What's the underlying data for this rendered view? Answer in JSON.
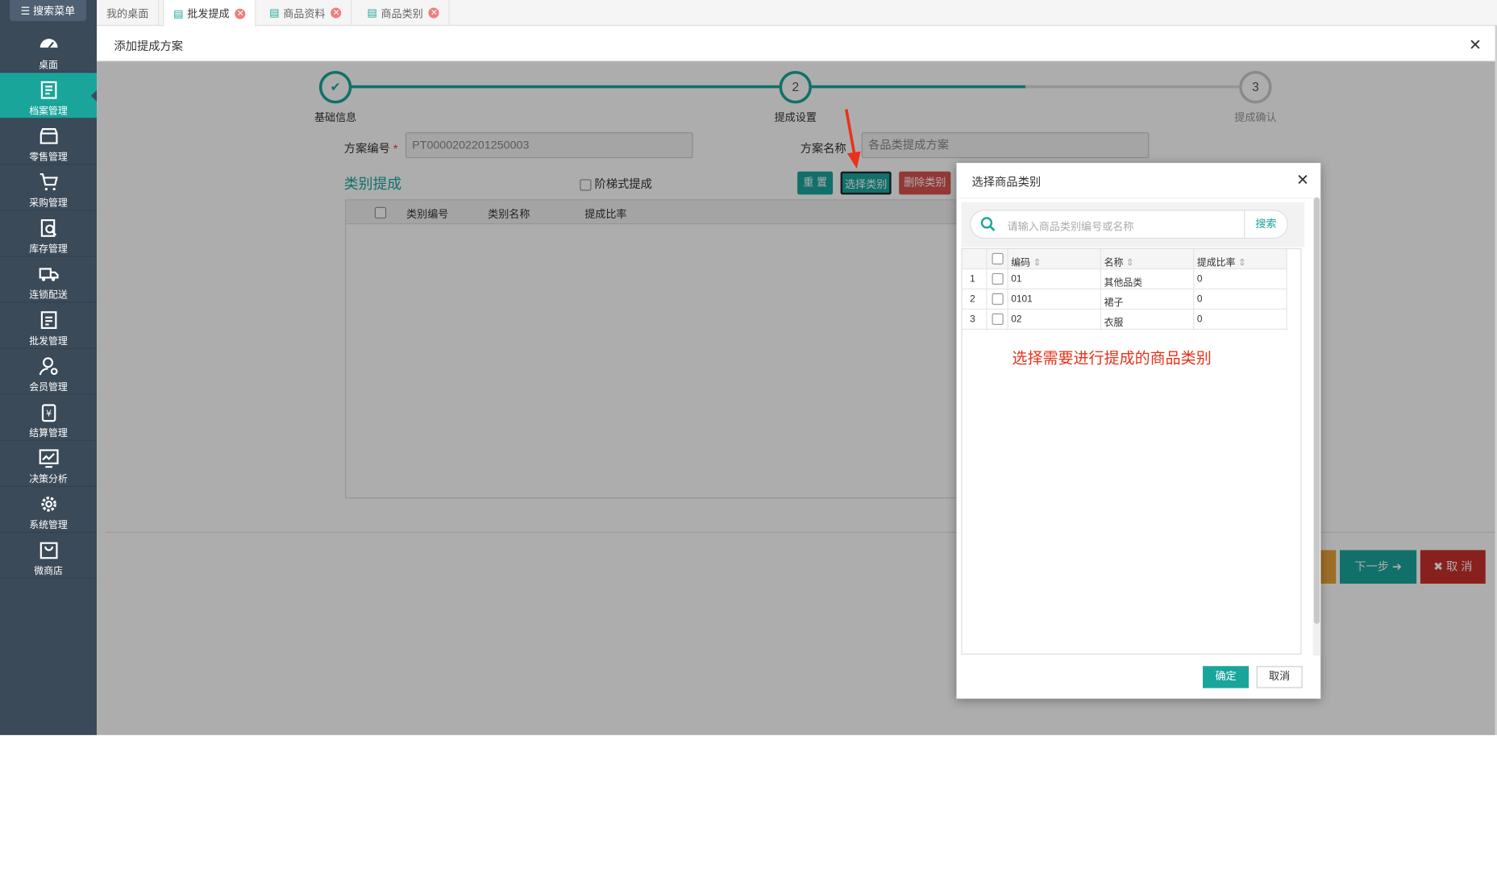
{
  "sidebar": {
    "search_menu": "搜索菜单",
    "items": [
      {
        "label": "桌面",
        "icon": "dashboard-icon"
      },
      {
        "label": "档案管理",
        "icon": "archive-icon"
      },
      {
        "label": "零售管理",
        "icon": "store-icon"
      },
      {
        "label": "采购管理",
        "icon": "cart-icon"
      },
      {
        "label": "库存管理",
        "icon": "inventory-icon"
      },
      {
        "label": "连锁配送",
        "icon": "truck-icon"
      },
      {
        "label": "批发管理",
        "icon": "wholesale-icon"
      },
      {
        "label": "会员管理",
        "icon": "member-icon"
      },
      {
        "label": "结算管理",
        "icon": "settlement-icon"
      },
      {
        "label": "决策分析",
        "icon": "chart-icon"
      },
      {
        "label": "系统管理",
        "icon": "gear-icon"
      },
      {
        "label": "微商店",
        "icon": "bag-icon"
      }
    ],
    "active_index": 1
  },
  "tabs": [
    {
      "label": "我的桌面"
    },
    {
      "label": "批发提成"
    },
    {
      "label": "商品资料"
    },
    {
      "label": "商品类别"
    }
  ],
  "dialog": {
    "title": "添加提成方案",
    "close": "✕"
  },
  "steps": [
    {
      "label": "基础信息",
      "num": "✔"
    },
    {
      "label": "提成设置",
      "num": "2"
    },
    {
      "label": "提成确认",
      "num": "3"
    }
  ],
  "form": {
    "plan_no_label": "方案编号",
    "required_mark": "*",
    "plan_no_value": "PT0000202201250003",
    "plan_name_label": "方案名称",
    "plan_name_value": "各品类提成方案",
    "section_title": "类别提成",
    "tiered_label": "阶梯式提成",
    "btn_reset": "重 置",
    "btn_select": "选择类别",
    "btn_delete": "删除类别",
    "table_headers": [
      "类别编号",
      "类别名称",
      "提成比率"
    ]
  },
  "bottom_buttons": {
    "next": "下一步 ➔",
    "cancel": "✖ 取 消"
  },
  "modal": {
    "title": "选择商品类别",
    "close": "✕",
    "search_placeholder": "请输入商品类别编号或名称",
    "search_button": "搜索",
    "headers": [
      "编码",
      "名称",
      "提成比率"
    ],
    "rows": [
      {
        "idx": "1",
        "code": "01",
        "name": "其他品类",
        "rate": "0"
      },
      {
        "idx": "2",
        "code": "0101",
        "name": "裙子",
        "rate": "0"
      },
      {
        "idx": "3",
        "code": "02",
        "name": "衣服",
        "rate": "0"
      }
    ],
    "hint": "选择需要进行提成的商品类别",
    "ok": "确定",
    "cancel": "取消"
  },
  "colors": {
    "accent": "#1aa59b",
    "sidebar_bg": "#3b4a59",
    "danger": "#c0392b",
    "annotation_red": "#e8321a"
  }
}
